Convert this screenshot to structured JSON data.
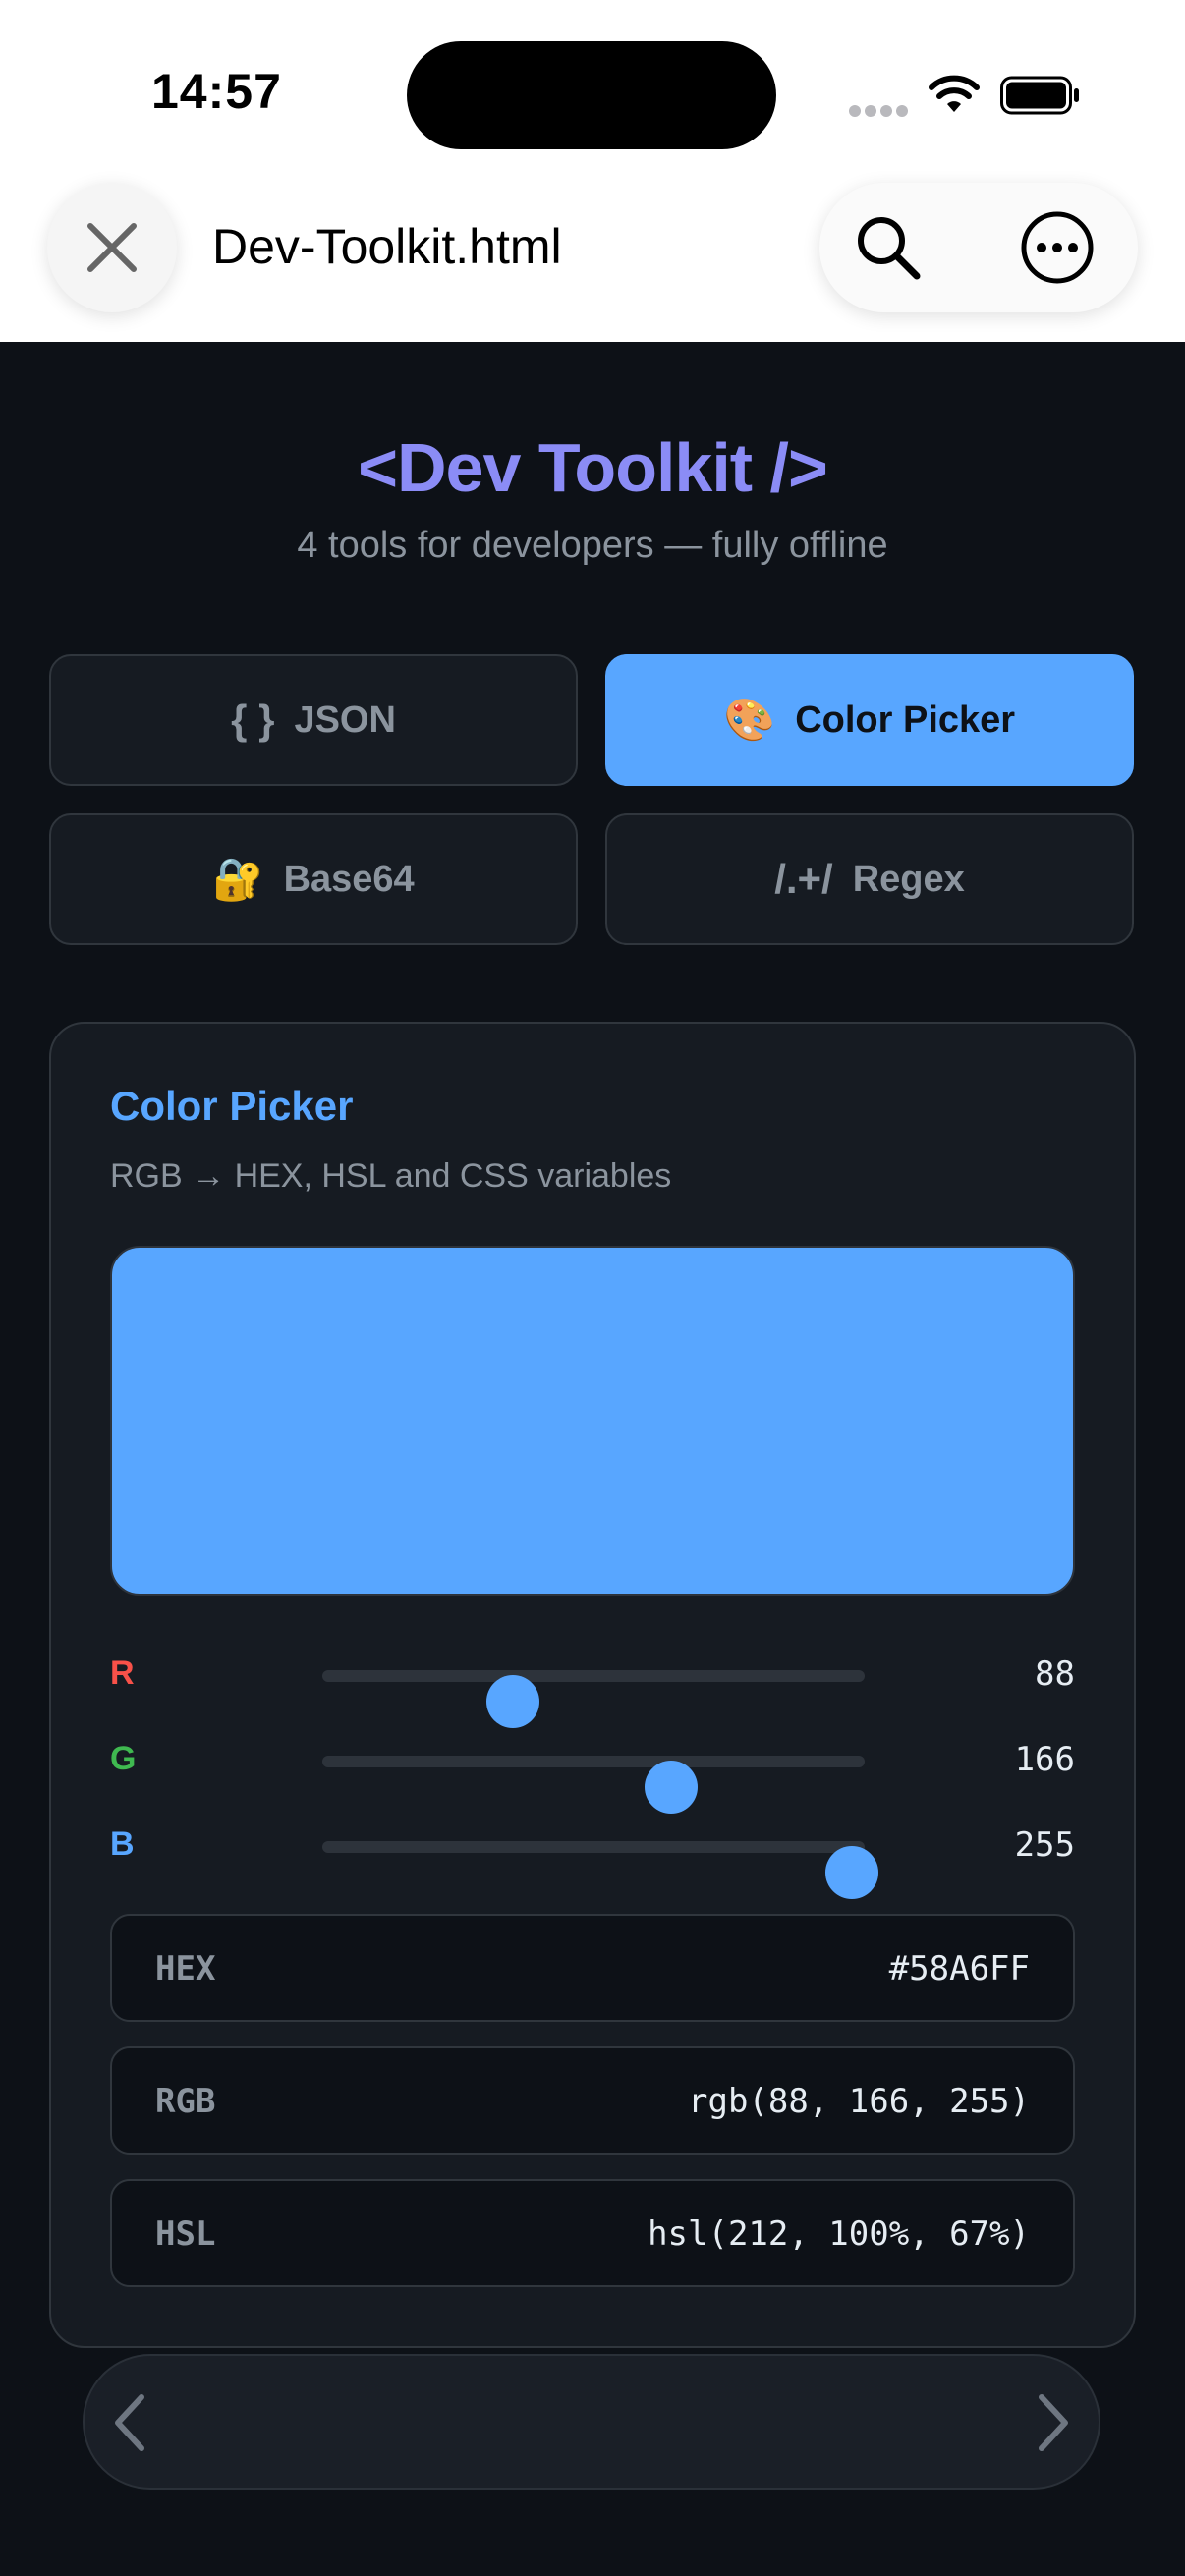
{
  "status_bar": {
    "time": "14:57"
  },
  "browser": {
    "title": "Dev-Toolkit.html"
  },
  "app": {
    "title": "<Dev Toolkit />",
    "subtitle": "4 tools for developers — fully offline"
  },
  "tabs": [
    {
      "icon": "{ }",
      "label": "JSON",
      "active": false
    },
    {
      "icon": "🎨",
      "label": "Color Picker",
      "active": true
    },
    {
      "icon": "🔐",
      "label": "Base64",
      "active": false
    },
    {
      "icon": "/.+/",
      "label": "Regex",
      "active": false
    }
  ],
  "panel": {
    "title": "Color Picker",
    "subtitle": "RGB → HEX, HSL and CSS variables",
    "swatch_color": "#58A6FF",
    "sliders": [
      {
        "label": "R",
        "value": "88",
        "fraction": 0.345,
        "color": "#f85149"
      },
      {
        "label": "G",
        "value": "166",
        "fraction": 0.651,
        "color": "#3fb950"
      },
      {
        "label": "B",
        "value": "255",
        "fraction": 1.0,
        "color": "#58a6ff"
      }
    ],
    "outputs": [
      {
        "key": "HEX",
        "value": "#58A6FF"
      },
      {
        "key": "RGB",
        "value": "rgb(88, 166, 255)"
      },
      {
        "key": "HSL",
        "value": "hsl(212, 100%, 67%)"
      }
    ]
  },
  "icons": {
    "close": "close-icon",
    "search": "search-icon",
    "more": "more-icon",
    "back": "chevron-left-icon",
    "forward": "chevron-right-icon"
  }
}
